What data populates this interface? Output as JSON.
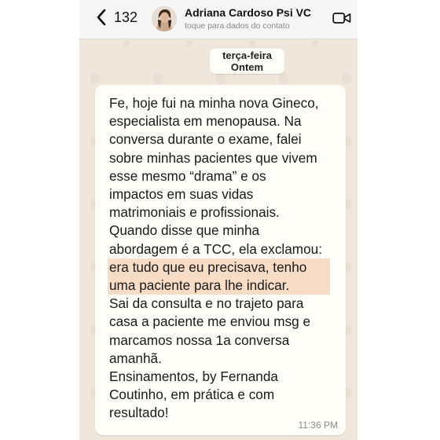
{
  "header": {
    "back_count": "132",
    "contact_name": "Adriana Cardoso Psi VC",
    "contact_subtitle": "toque para dados do contato"
  },
  "date_separator": {
    "weekday": "terça-feira",
    "relative": "Ontem"
  },
  "message": {
    "lines": [
      "Fe, hoje fui na minha nova Gineco,",
      "especialista em menopausa. Na",
      "conversa durante o exame, falei",
      "sobre minhas pacientes que vivem",
      "esse mesmo “drama” e os",
      "impactos em suas vidas",
      "matrimoniais e profissionais.",
      "Quando disse que minha",
      "abordagem é a TCC, ela exclamou:",
      "era tudo que eu precisava, tenho",
      "uma paciente para lhe indicar.",
      "Sai da consulta e no trajeto para",
      "casa a paciente me enviou msg e",
      "marcamos nossa 1a conversa",
      "amanhã.",
      "Ensinamentos, by Fernanda",
      "Coutinho, em prática e com",
      "resultado!"
    ],
    "time": "11:36 PM"
  },
  "icons": {
    "back": "chevron-left-icon",
    "video": "video-camera-icon"
  },
  "colors": {
    "chat_background": "#efe7dc",
    "bubble": "#fffdf8",
    "highlight": "#f9dcc6",
    "header": "#f6f6f6"
  }
}
